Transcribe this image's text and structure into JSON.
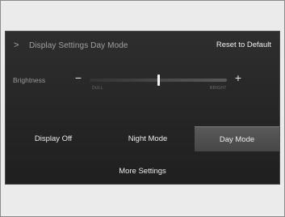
{
  "header": {
    "chevron_icon": "chevron-right-icon",
    "chevron_glyph": ">",
    "title": "Display Settings Day Mode",
    "reset_label": "Reset to Default"
  },
  "brightness": {
    "label": "Brightness",
    "minus_glyph": "−",
    "plus_glyph": "+",
    "min_label": "DULL",
    "max_label": "BRIGHT",
    "level_fraction": 0.5
  },
  "modes": {
    "display_off": "Display Off",
    "night_mode": "Night Mode",
    "day_mode": "Day Mode",
    "selected": "Day Mode"
  },
  "more_settings": "More Settings"
}
